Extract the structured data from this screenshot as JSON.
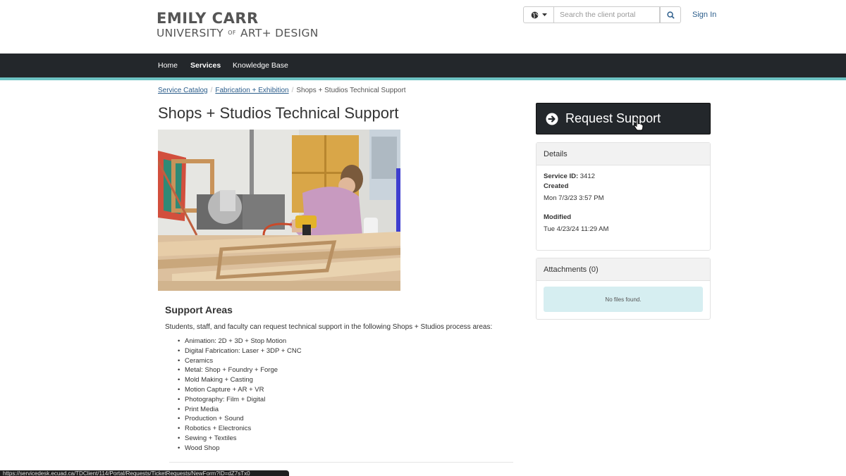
{
  "brand": {
    "line1": "EMILY CARR",
    "line2_a": "UNIVERSITY",
    "line2_of": "OF",
    "line2_b": "ART+ DESIGN"
  },
  "header": {
    "search_placeholder": "Search the client portal",
    "sign_in": "Sign In"
  },
  "nav": {
    "items": [
      "Home",
      "Services",
      "Knowledge Base"
    ],
    "active": "Services"
  },
  "breadcrumb": {
    "items": [
      "Service Catalog",
      "Fabrication + Exhibition",
      "Shops + Studios Technical Support"
    ]
  },
  "page": {
    "title": "Shops + Studios Technical Support"
  },
  "support_areas": {
    "title": "Support Areas",
    "intro": "Students, staff, and faculty can request technical support in the following Shops + Studios process areas:",
    "items": [
      "Animation: 2D + 3D + Stop Motion",
      "Digital Fabrication: Laser + 3DP + CNC",
      "Ceramics",
      "Metal: Shop + Foundry + Forge",
      "Mold Making + Casting",
      "Motion Capture + AR + VR",
      "Photography: Film + Digital",
      "Print Media",
      "Production + Sound",
      "Robotics + Electronics",
      "Sewing + Textiles",
      "Wood Shop"
    ]
  },
  "request_button": {
    "label": "Request Support"
  },
  "details": {
    "title": "Details",
    "service_id_label": "Service ID:",
    "service_id": "3412",
    "created_label": "Created",
    "created": "Mon 7/3/23 3:57 PM",
    "modified_label": "Modified",
    "modified": "Tue 4/23/24 11:29 AM"
  },
  "attachments": {
    "title": "Attachments (0)",
    "empty": "No files found."
  },
  "statusbar": {
    "url": "https://servicedesk.ecuad.ca/TDClient/114/Portal/Requests/TicketRequests/NewForm?ID=dZ7sTx0"
  },
  "colors": {
    "nav_bg": "#23272b",
    "accent": "#6cc3c3",
    "link": "#2b5d8b",
    "alert_bg": "#d6eef1"
  }
}
